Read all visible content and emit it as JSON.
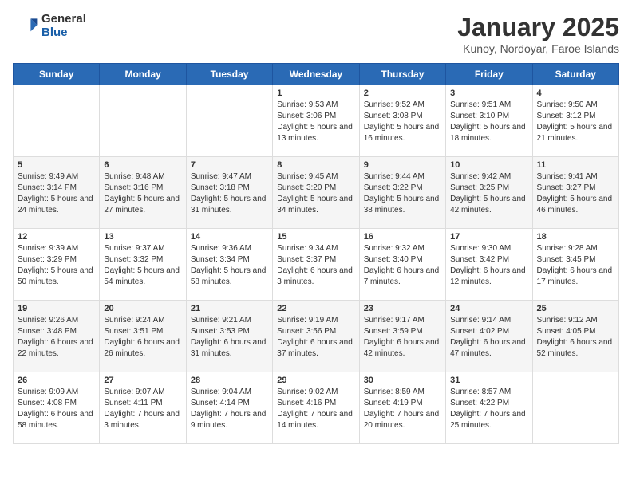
{
  "logo": {
    "general": "General",
    "blue": "Blue"
  },
  "title": "January 2025",
  "location": "Kunoy, Nordoyar, Faroe Islands",
  "days_of_week": [
    "Sunday",
    "Monday",
    "Tuesday",
    "Wednesday",
    "Thursday",
    "Friday",
    "Saturday"
  ],
  "weeks": [
    [
      null,
      null,
      null,
      {
        "day": "1",
        "sunrise": "9:53 AM",
        "sunset": "3:06 PM",
        "daylight": "5 hours and 13 minutes."
      },
      {
        "day": "2",
        "sunrise": "9:52 AM",
        "sunset": "3:08 PM",
        "daylight": "5 hours and 16 minutes."
      },
      {
        "day": "3",
        "sunrise": "9:51 AM",
        "sunset": "3:10 PM",
        "daylight": "5 hours and 18 minutes."
      },
      {
        "day": "4",
        "sunrise": "9:50 AM",
        "sunset": "3:12 PM",
        "daylight": "5 hours and 21 minutes."
      }
    ],
    [
      {
        "day": "5",
        "sunrise": "9:49 AM",
        "sunset": "3:14 PM",
        "daylight": "5 hours and 24 minutes."
      },
      {
        "day": "6",
        "sunrise": "9:48 AM",
        "sunset": "3:16 PM",
        "daylight": "5 hours and 27 minutes."
      },
      {
        "day": "7",
        "sunrise": "9:47 AM",
        "sunset": "3:18 PM",
        "daylight": "5 hours and 31 minutes."
      },
      {
        "day": "8",
        "sunrise": "9:45 AM",
        "sunset": "3:20 PM",
        "daylight": "5 hours and 34 minutes."
      },
      {
        "day": "9",
        "sunrise": "9:44 AM",
        "sunset": "3:22 PM",
        "daylight": "5 hours and 38 minutes."
      },
      {
        "day": "10",
        "sunrise": "9:42 AM",
        "sunset": "3:25 PM",
        "daylight": "5 hours and 42 minutes."
      },
      {
        "day": "11",
        "sunrise": "9:41 AM",
        "sunset": "3:27 PM",
        "daylight": "5 hours and 46 minutes."
      }
    ],
    [
      {
        "day": "12",
        "sunrise": "9:39 AM",
        "sunset": "3:29 PM",
        "daylight": "5 hours and 50 minutes."
      },
      {
        "day": "13",
        "sunrise": "9:37 AM",
        "sunset": "3:32 PM",
        "daylight": "5 hours and 54 minutes."
      },
      {
        "day": "14",
        "sunrise": "9:36 AM",
        "sunset": "3:34 PM",
        "daylight": "5 hours and 58 minutes."
      },
      {
        "day": "15",
        "sunrise": "9:34 AM",
        "sunset": "3:37 PM",
        "daylight": "6 hours and 3 minutes."
      },
      {
        "day": "16",
        "sunrise": "9:32 AM",
        "sunset": "3:40 PM",
        "daylight": "6 hours and 7 minutes."
      },
      {
        "day": "17",
        "sunrise": "9:30 AM",
        "sunset": "3:42 PM",
        "daylight": "6 hours and 12 minutes."
      },
      {
        "day": "18",
        "sunrise": "9:28 AM",
        "sunset": "3:45 PM",
        "daylight": "6 hours and 17 minutes."
      }
    ],
    [
      {
        "day": "19",
        "sunrise": "9:26 AM",
        "sunset": "3:48 PM",
        "daylight": "6 hours and 22 minutes."
      },
      {
        "day": "20",
        "sunrise": "9:24 AM",
        "sunset": "3:51 PM",
        "daylight": "6 hours and 26 minutes."
      },
      {
        "day": "21",
        "sunrise": "9:21 AM",
        "sunset": "3:53 PM",
        "daylight": "6 hours and 31 minutes."
      },
      {
        "day": "22",
        "sunrise": "9:19 AM",
        "sunset": "3:56 PM",
        "daylight": "6 hours and 37 minutes."
      },
      {
        "day": "23",
        "sunrise": "9:17 AM",
        "sunset": "3:59 PM",
        "daylight": "6 hours and 42 minutes."
      },
      {
        "day": "24",
        "sunrise": "9:14 AM",
        "sunset": "4:02 PM",
        "daylight": "6 hours and 47 minutes."
      },
      {
        "day": "25",
        "sunrise": "9:12 AM",
        "sunset": "4:05 PM",
        "daylight": "6 hours and 52 minutes."
      }
    ],
    [
      {
        "day": "26",
        "sunrise": "9:09 AM",
        "sunset": "4:08 PM",
        "daylight": "6 hours and 58 minutes."
      },
      {
        "day": "27",
        "sunrise": "9:07 AM",
        "sunset": "4:11 PM",
        "daylight": "7 hours and 3 minutes."
      },
      {
        "day": "28",
        "sunrise": "9:04 AM",
        "sunset": "4:14 PM",
        "daylight": "7 hours and 9 minutes."
      },
      {
        "day": "29",
        "sunrise": "9:02 AM",
        "sunset": "4:16 PM",
        "daylight": "7 hours and 14 minutes."
      },
      {
        "day": "30",
        "sunrise": "8:59 AM",
        "sunset": "4:19 PM",
        "daylight": "7 hours and 20 minutes."
      },
      {
        "day": "31",
        "sunrise": "8:57 AM",
        "sunset": "4:22 PM",
        "daylight": "7 hours and 25 minutes."
      },
      null
    ]
  ]
}
